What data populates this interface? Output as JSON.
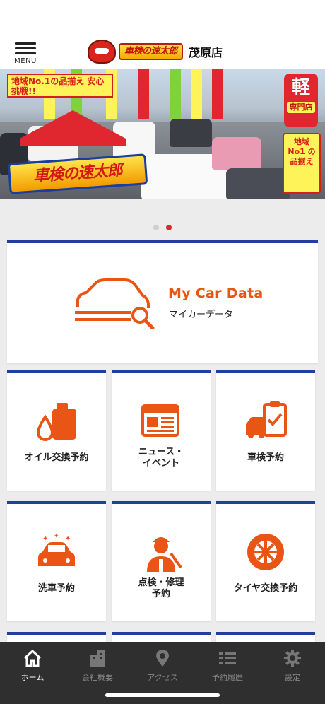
{
  "header": {
    "menu_label": "MENU",
    "brand_logo_text": "車検の速太郎",
    "store_name": "茂原店"
  },
  "banner": {
    "sign_text": "地域No.1の品揃え 安心挑戦!!",
    "logo_text": "車検の速太郎",
    "kei_text": "軽",
    "kei_sub": "専門店",
    "side_text": "地域 No1 の 品揃え",
    "slide_count": 2,
    "active_slide": 2
  },
  "colors": {
    "accent": "#e85514",
    "card_border": "#233f9c",
    "active_dot": "#e4262c",
    "tabbar": "#2f2f2f"
  },
  "mycar": {
    "title": "My Car Data",
    "subtitle": "マイカーデータ",
    "icon": "car-search-icon"
  },
  "tiles": [
    {
      "label": "オイル交換予約",
      "icon": "oil-can-icon"
    },
    {
      "label": "ニュース・\nイベント",
      "icon": "newspaper-icon"
    },
    {
      "label": "車検予約",
      "icon": "car-checklist-icon"
    },
    {
      "label": "洗車予約",
      "icon": "car-wash-icon"
    },
    {
      "label": "点検・修理\n予約",
      "icon": "mechanic-icon"
    },
    {
      "label": "タイヤ交換予約",
      "icon": "tire-icon"
    }
  ],
  "tabbar": {
    "items": [
      {
        "label": "ホーム",
        "icon": "home-icon",
        "active": true
      },
      {
        "label": "会社概要",
        "icon": "building-icon",
        "active": false
      },
      {
        "label": "アクセス",
        "icon": "map-pin-icon",
        "active": false
      },
      {
        "label": "予約履歴",
        "icon": "list-icon",
        "active": false
      },
      {
        "label": "設定",
        "icon": "gear-icon",
        "active": false
      }
    ]
  }
}
